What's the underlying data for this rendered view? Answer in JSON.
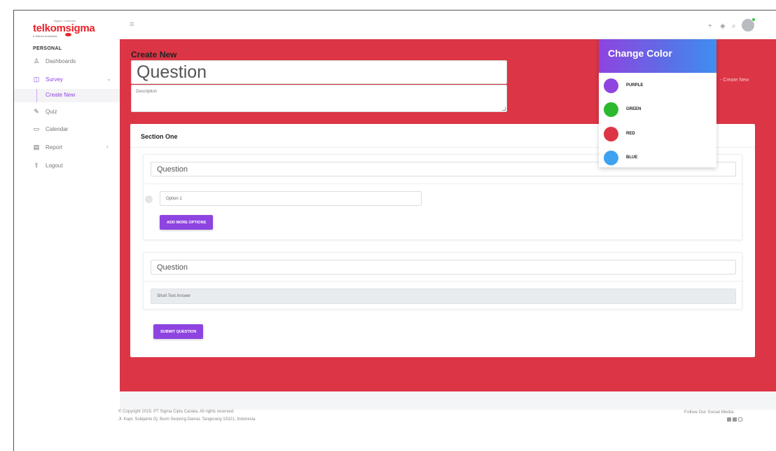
{
  "brand": {
    "tagline": "bigger • company",
    "name": "telkomsigma",
    "sub": "a Telkom Indonesia"
  },
  "sidebar": {
    "heading": "PERSONAL",
    "items": [
      {
        "label": "Dashboards",
        "icon": "dashboard-icon"
      },
      {
        "label": "Survey",
        "icon": "book-icon"
      },
      {
        "label": "Quiz",
        "icon": "edit-icon"
      },
      {
        "label": "Calendar",
        "icon": "calendar-icon"
      },
      {
        "label": "Report",
        "icon": "report-icon"
      },
      {
        "label": "Logout",
        "icon": "logout-icon"
      }
    ],
    "sub_item": "Create New"
  },
  "topbar": {
    "icons": [
      "plus-icon",
      "paint-bucket-icon",
      "search-icon"
    ],
    "avatar_status_color": "#35c43a"
  },
  "hero": {
    "title": "Create New",
    "question_value": "Question",
    "description_placeholder": "Description",
    "breadcrumb": "- Create New",
    "background": "#dc3545"
  },
  "section": {
    "title": "Section One",
    "question1": {
      "question": "Question",
      "option": "Option 1",
      "add_button": "ADD MORE OPTIONS"
    },
    "question2": {
      "question": "Question",
      "answer_placeholder": "Short Text Answer"
    },
    "submit_button": "SUBMIT QUESTION"
  },
  "palette": {
    "title": "Change Color",
    "options": [
      {
        "label": "PURPLE",
        "color": "#8e44e0"
      },
      {
        "label": "GREEN",
        "color": "#2eb82e"
      },
      {
        "label": "RED",
        "color": "#dc3545"
      },
      {
        "label": "BLUE",
        "color": "#3fa2f0"
      }
    ]
  },
  "footer": {
    "copyright": "© Copyright 2019. PT Sigma Cipta Caraka. All rights reserved.",
    "address": "Jl. Kapt. Subijanto Dj. Bumi Serpong Damai, Tangerang 15321, Indonesia",
    "follow": "Follow Our Social Media",
    "socials": [
      "facebook-icon",
      "youtube-icon",
      "instagram-icon"
    ]
  }
}
